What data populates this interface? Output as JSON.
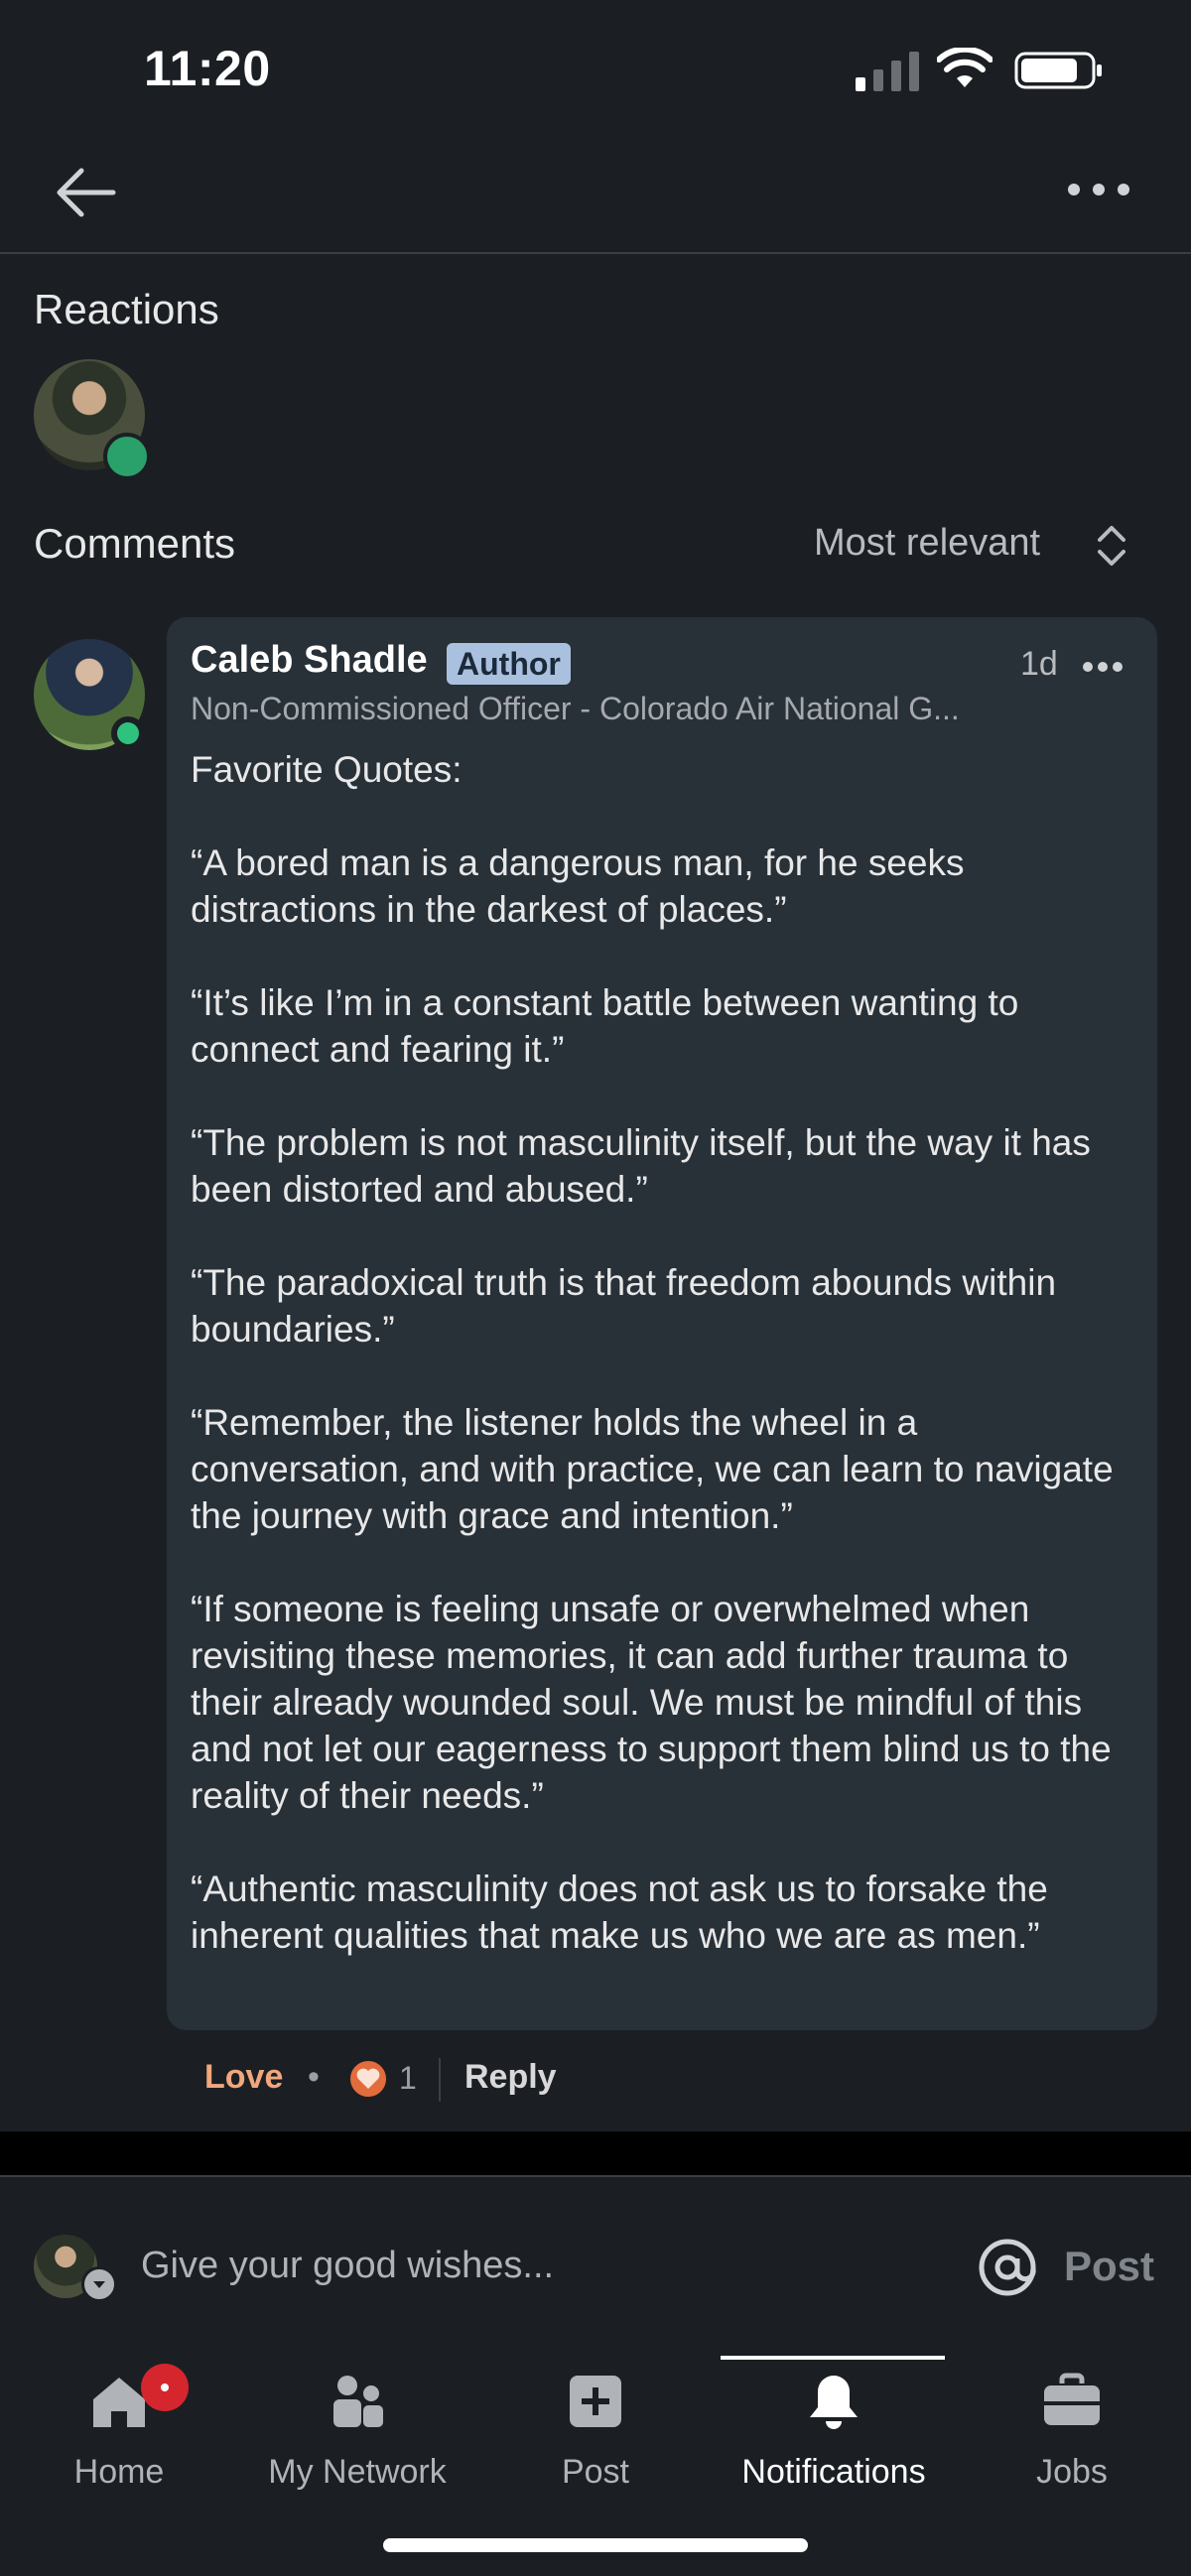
{
  "status_bar": {
    "time": "11:20"
  },
  "header": {
    "back_icon": "back-arrow-icon",
    "more_icon": "more-horizontal-icon"
  },
  "reactions": {
    "title": "Reactions"
  },
  "comments": {
    "title": "Comments",
    "sort_label": "Most relevant",
    "items": [
      {
        "author": "Caleb Shadle",
        "badge": "Author",
        "time": "1d",
        "headline": "Non-Commissioned Officer - Colorado Air National G...",
        "paragraphs": [
          "Favorite Quotes:",
          "“A bored man is a dangerous man, for he seeks distractions in the darkest of places.”",
          "“It’s like I’m in a constant battle between wanting to connect and fearing it.”",
          "“The problem is not masculinity itself, but the way it has been distorted and abused.”",
          "“The paradoxical truth is that freedom abounds within boundaries.”",
          "“Remember, the listener holds the wheel in a conversation, and with practice, we can learn to navigate the journey with grace and intention.”",
          "“If someone is feeling unsafe or overwhelmed when revisiting these memories, it can add further trauma to their already wounded soul. We must be mindful of this and not let our eagerness to support them blind us to the reality of their needs.”",
          "“Authentic masculinity does not ask us to forsake the inherent qualities that make us who we are as men.”"
        ],
        "actions": {
          "love": "Love",
          "separator": "•",
          "love_count": "1",
          "reply": "Reply"
        }
      }
    ]
  },
  "compose": {
    "placeholder": "Give your good wishes...",
    "mention_symbol": "@",
    "post_label": "Post"
  },
  "tabs": [
    {
      "label": "Home",
      "icon": "home-icon"
    },
    {
      "label": "My Network",
      "icon": "network-icon"
    },
    {
      "label": "Post",
      "icon": "post-plus-icon"
    },
    {
      "label": "Notifications",
      "icon": "bell-icon"
    },
    {
      "label": "Jobs",
      "icon": "briefcase-icon"
    }
  ],
  "colors": {
    "background": "#1b1f23",
    "bubble": "#283038",
    "love": "#f1a77c",
    "online": "#2ec27e",
    "notification": "#d6262d"
  }
}
